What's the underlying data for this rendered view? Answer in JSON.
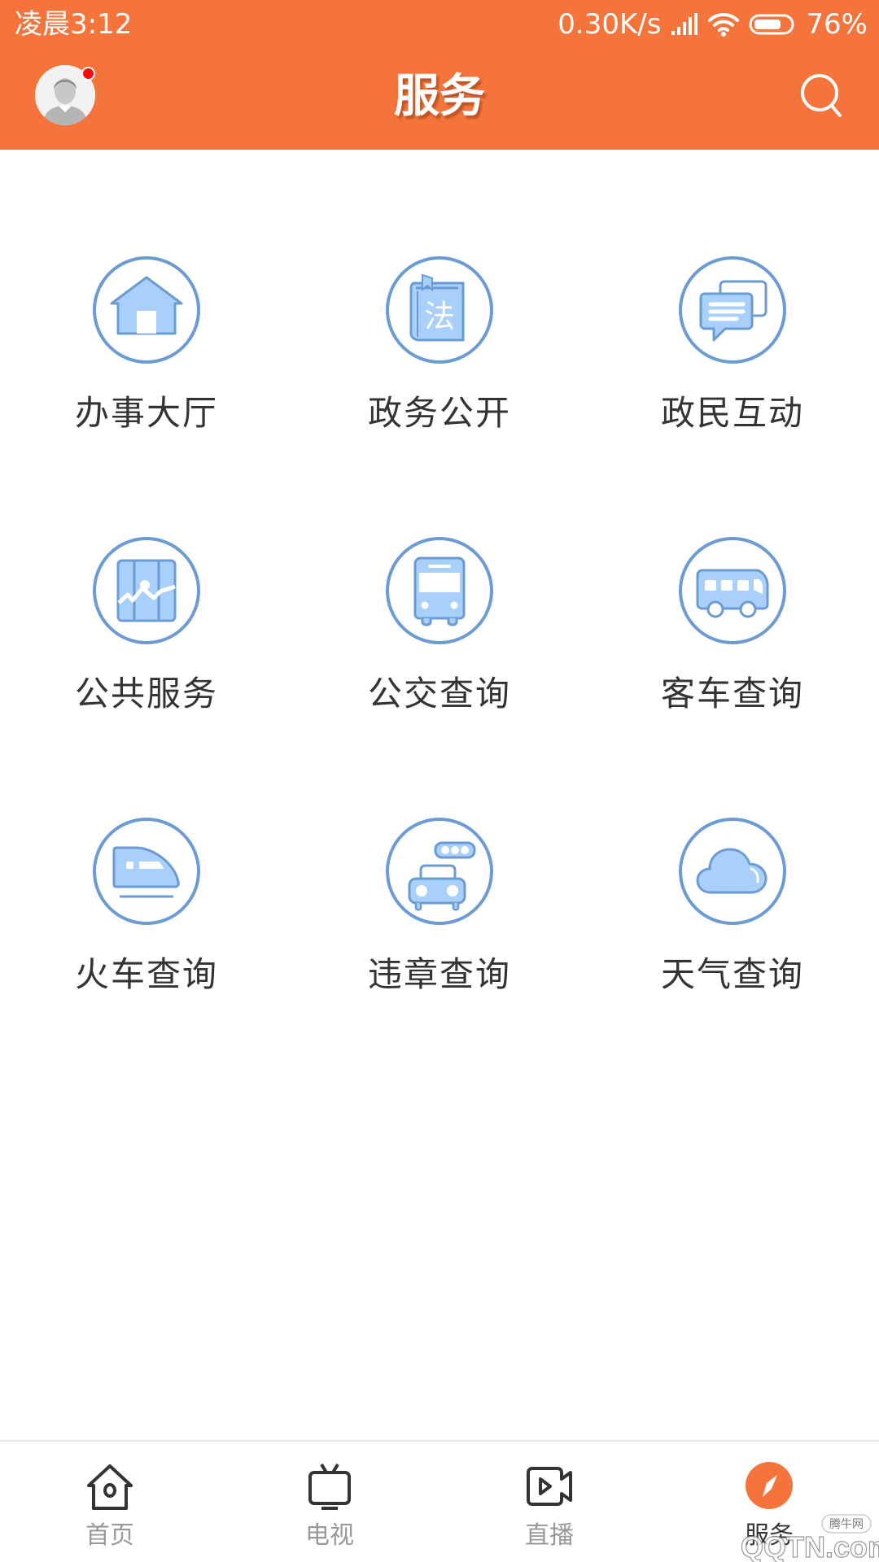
{
  "status_bar": {
    "time": "凌晨3:12",
    "network_speed": "0.30K/s",
    "signal_icon": "signal-bars-icon",
    "wifi_icon": "wifi-icon",
    "battery_icon": "battery-icon",
    "battery_level": 76,
    "battery_text": "76%"
  },
  "header": {
    "title": "服务",
    "avatar_icon": "user-avatar-icon",
    "has_notification": true,
    "search_icon": "search-icon",
    "background_color": "#f4743b"
  },
  "services": [
    {
      "label": "办事大厅",
      "icon": "house-icon"
    },
    {
      "label": "政务公开",
      "icon": "law-book-icon",
      "icon_text": "法"
    },
    {
      "label": "政民互动",
      "icon": "chat-bubbles-icon"
    },
    {
      "label": "公共服务",
      "icon": "map-chart-icon"
    },
    {
      "label": "公交查询",
      "icon": "bus-front-icon"
    },
    {
      "label": "客车查询",
      "icon": "coach-bus-icon"
    },
    {
      "label": "火车查询",
      "icon": "train-icon"
    },
    {
      "label": "违章查询",
      "icon": "car-traffic-light-icon"
    },
    {
      "label": "天气查询",
      "icon": "cloud-icon"
    }
  ],
  "tabbar": {
    "items": [
      {
        "label": "首页",
        "icon": "home-icon",
        "active": false
      },
      {
        "label": "电视",
        "icon": "tv-icon",
        "active": false
      },
      {
        "label": "直播",
        "icon": "video-camera-icon",
        "active": false
      },
      {
        "label": "服务",
        "icon": "compass-icon",
        "active": true
      }
    ],
    "active_color": "#f4743b"
  },
  "watermark": {
    "text": "QQTN.com",
    "sub_text": "腾牛网"
  },
  "colors": {
    "icon_stroke": "#6b9bd2",
    "icon_fill": "#a9d0fb",
    "label_text": "#333333",
    "tab_text": "#999999"
  }
}
